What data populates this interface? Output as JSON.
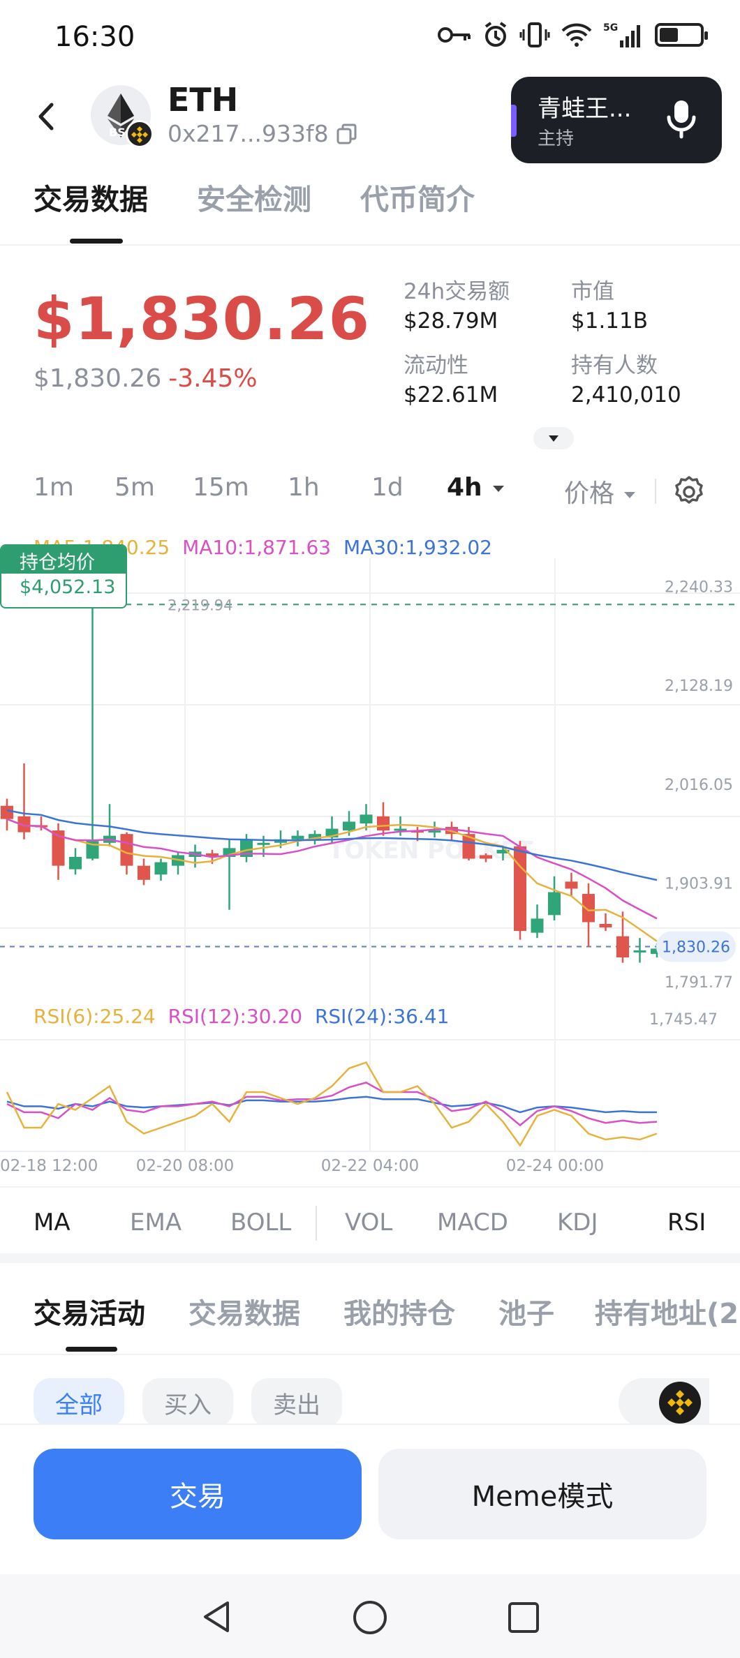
{
  "status": {
    "time": "16:30",
    "network": "5G"
  },
  "header": {
    "symbol": "ETH",
    "address": "0x217...933f8",
    "avatar_badge": "BS",
    "live": {
      "title": "青蛙王...",
      "subtitle": "主持"
    }
  },
  "tabs_top": [
    {
      "label": "交易数据",
      "active": true
    },
    {
      "label": "安全检测",
      "active": false
    },
    {
      "label": "代币简介",
      "active": false
    }
  ],
  "price": {
    "main": "$1,830.26",
    "sub": "$1,830.26",
    "change": "-3.45%"
  },
  "stats": [
    {
      "label": "24h交易额",
      "value": "$28.79M"
    },
    {
      "label": "市值",
      "value": "$1.11B"
    },
    {
      "label": "流动性",
      "value": "$22.61M"
    },
    {
      "label": "持有人数",
      "value": "2,410,010"
    }
  ],
  "timeframes": [
    "1m",
    "5m",
    "15m",
    "1h",
    "1d",
    "4h"
  ],
  "active_timeframe": "4h",
  "price_selector": "价格",
  "ma_legend": {
    "ma5": "MA5:1,840.25",
    "ma10": "MA10:1,871.63",
    "ma30": "MA30:1,932.02"
  },
  "avg_cost": {
    "label": "持仓均价",
    "value": "$4,052.13"
  },
  "rsi_legend": {
    "rsi6": "RSI(6):25.24",
    "rsi12": "RSI(12):30.20",
    "rsi24": "RSI(24):36.41"
  },
  "colors": {
    "up": "#2ea67a",
    "down": "#e0554c",
    "ma5": "#e6b23c",
    "ma10": "#d84fc7",
    "ma30": "#3b74d6",
    "accent": "#3b7ef5",
    "price_red": "#d94c48"
  },
  "chart_data": {
    "type": "candlestick",
    "y_axis_labels": [
      "2,240.33",
      "2,128.19",
      "2,016.05",
      "1,903.91",
      "1,791.77"
    ],
    "ylim": [
      1780,
      2255
    ],
    "x_labels": [
      "02-18 12:00",
      "02-20 08:00",
      "02-22 04:00",
      "02-24 00:00"
    ],
    "annotations": {
      "high": "2,219.94",
      "current": "1,830.26",
      "low": "1,745.47"
    },
    "current_price": 1830.26,
    "candles": [
      [
        1990,
        1975,
        1998,
        1962
      ],
      [
        1978,
        1960,
        2038,
        1952
      ],
      [
        1968,
        1966,
        1978,
        1962
      ],
      [
        1962,
        1922,
        1970,
        1906
      ],
      [
        1918,
        1932,
        1942,
        1912
      ],
      [
        1930,
        1950,
        2219.94,
        1928
      ],
      [
        1948,
        1956,
        1992,
        1944
      ],
      [
        1958,
        1922,
        1960,
        1912
      ],
      [
        1922,
        1906,
        1930,
        1900
      ],
      [
        1912,
        1926,
        1930,
        1905
      ],
      [
        1922,
        1934,
        1938,
        1912
      ],
      [
        1932,
        1938,
        1946,
        1920
      ],
      [
        1936,
        1932,
        1940,
        1924
      ],
      [
        1932,
        1942,
        1952,
        1872
      ],
      [
        1932,
        1952,
        1958,
        1926
      ],
      [
        1948,
        1948,
        1956,
        1932
      ],
      [
        1948,
        1952,
        1962,
        1942
      ],
      [
        1952,
        1956,
        1962,
        1944
      ],
      [
        1952,
        1958,
        1962,
        1946
      ],
      [
        1954,
        1964,
        1978,
        1948
      ],
      [
        1962,
        1972,
        1984,
        1956
      ],
      [
        1970,
        1980,
        1992,
        1962
      ],
      [
        1978,
        1962,
        1994,
        1956
      ],
      [
        1962,
        1964,
        1978,
        1956
      ],
      [
        1962,
        1960,
        1966,
        1950
      ],
      [
        1962,
        1962,
        1972,
        1954
      ],
      [
        1966,
        1958,
        1972,
        1950
      ],
      [
        1958,
        1930,
        1966,
        1928
      ],
      [
        1934,
        1930,
        1936,
        1926
      ],
      [
        1936,
        1940,
        1944,
        1928
      ],
      [
        1944,
        1848,
        1950,
        1838
      ],
      [
        1846,
        1862,
        1878,
        1840
      ],
      [
        1866,
        1892,
        1910,
        1860
      ],
      [
        1904,
        1896,
        1914,
        1888
      ],
      [
        1890,
        1858,
        1902,
        1830
      ],
      [
        1856,
        1852,
        1868,
        1848
      ],
      [
        1842,
        1818,
        1870,
        1812
      ],
      [
        1826,
        1826,
        1840,
        1812
      ],
      [
        1822,
        1828,
        1834,
        1818
      ]
    ],
    "rsi_ylim": [
      0,
      100
    ],
    "rsi6": [
      50,
      20,
      20,
      40,
      35,
      45,
      55,
      25,
      15,
      20,
      25,
      30,
      40,
      25,
      50,
      50,
      45,
      40,
      45,
      55,
      70,
      75,
      50,
      50,
      55,
      40,
      20,
      25,
      40,
      25,
      5,
      30,
      35,
      30,
      15,
      10,
      12,
      10,
      15
    ],
    "rsi12": [
      40,
      33,
      33,
      28,
      40,
      35,
      45,
      35,
      33,
      38,
      38,
      40,
      42,
      38,
      46,
      46,
      43,
      44,
      44,
      47,
      54,
      58,
      50,
      50,
      50,
      44,
      34,
      36,
      42,
      34,
      22,
      34,
      38,
      34,
      28,
      24,
      26,
      24,
      25
    ],
    "rsi24": [
      42,
      38,
      38,
      36,
      40,
      38,
      42,
      38,
      37,
      38,
      39,
      40,
      41,
      39,
      43,
      43,
      42,
      42,
      42,
      43,
      45,
      46,
      44,
      44,
      44,
      41,
      38,
      39,
      41,
      38,
      33,
      37,
      38,
      37,
      35,
      33,
      34,
      33,
      33
    ]
  },
  "indicators": [
    {
      "label": "MA",
      "active": true
    },
    {
      "label": "EMA",
      "active": false
    },
    {
      "label": "BOLL",
      "active": false
    },
    {
      "label": "VOL",
      "active": false
    },
    {
      "label": "MACD",
      "active": false
    },
    {
      "label": "KDJ",
      "active": false
    },
    {
      "label": "RSI",
      "active": true
    }
  ],
  "tabs_bottom": [
    {
      "label": "交易活动",
      "active": true
    },
    {
      "label": "交易数据",
      "active": false
    },
    {
      "label": "我的持仓",
      "active": false
    },
    {
      "label": "池子",
      "active": false
    },
    {
      "label": "持有地址(2",
      "active": false
    }
  ],
  "filters": [
    {
      "label": "全部",
      "active": true
    },
    {
      "label": "买入",
      "active": false
    },
    {
      "label": "卖出",
      "active": false
    }
  ],
  "actions": {
    "trade": "交易",
    "meme": "Meme模式"
  },
  "watermark": "TOKEN POCKET"
}
